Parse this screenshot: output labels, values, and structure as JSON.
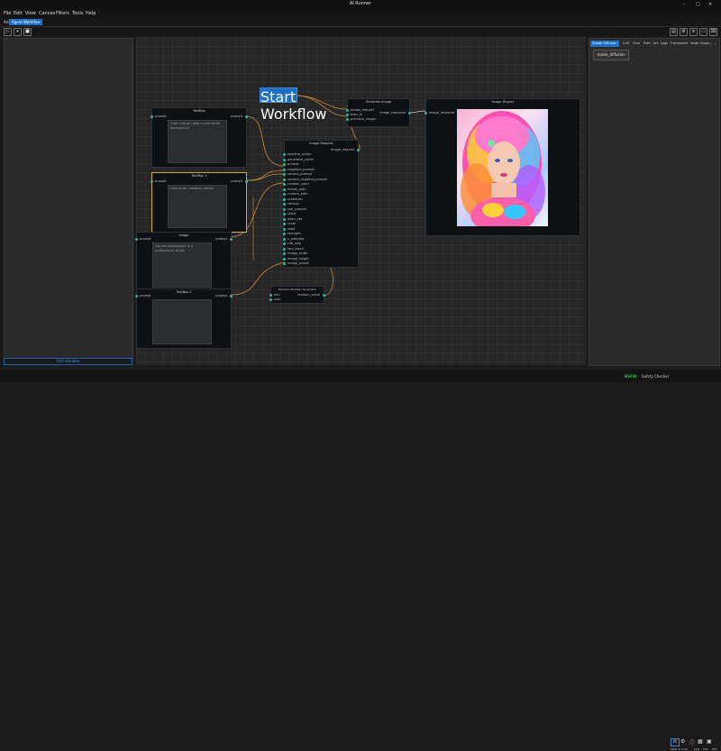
{
  "window": {
    "title": "AI Runner"
  },
  "menu": [
    "File",
    "Edit",
    "View",
    "Canvas",
    "Filters",
    "Tools",
    "Help"
  ],
  "tabs": {
    "home": "Art",
    "active": "Agent Workflow"
  },
  "left_panel": {
    "bottom_button": "Add Variable"
  },
  "nodes": {
    "start": {
      "title": "Start Workflow"
    },
    "textbox1": {
      "title": "TextBox",
      "in_port": "prompt",
      "out_port": "prompt",
      "text": "Cute cute girl with a cute smile, background"
    },
    "textbox2": {
      "title": "TextBox 1",
      "in_port": "prompt",
      "out_port": "prompt",
      "text": "Halo drum, drawing, sketch"
    },
    "textbox3": {
      "title": "Image",
      "in_port": "prompt",
      "out_port": "prompt",
      "text": "Fashion photograph in a professional studio"
    },
    "textbox4": {
      "title": "TextBox 2",
      "in_port": "prompt",
      "out_port": "prompt",
      "text": ""
    },
    "generate": {
      "title": "Generate Image",
      "inputs": [
        "image_request",
        "exec_in",
        "previous_image"
      ],
      "output": "image_response"
    },
    "display": {
      "title": "Image Display",
      "input": "image_response"
    },
    "request": {
      "title": "Image Request",
      "output": "image_request",
      "inputs": [
        "pipeline_action",
        "generator_name",
        "prompt",
        "negative_prompt",
        "second_prompt",
        "second_negative_prompt",
        "random_seed",
        "model_path",
        "custom_path",
        "scheduler",
        "version",
        "use_compel",
        "steps",
        "ddim_eta",
        "scale",
        "seed",
        "strength",
        "n_samples",
        "clip_skip",
        "lora_block",
        "image_width",
        "image_height",
        "image_preset"
      ]
    },
    "random": {
      "title": "Random Number Generator",
      "inputs": [
        "min",
        "max"
      ],
      "output": "random_value"
    }
  },
  "right_panel": {
    "tabs": [
      "Stable Diffusion",
      "LLM",
      "Chat",
      "Path",
      "Art",
      "Logs",
      "Framework",
      "Node Graph"
    ],
    "active_tab": "Stable Diffusion",
    "field": "stable_diffusion"
  },
  "status": {
    "nsfw": "NSFW",
    "safety": "Safety Checker",
    "model": "SDXL 1.0 C4",
    "llm": "LLM",
    "tts": "TTS",
    "stt": "STT",
    "nsfw_color": "#18c23a"
  }
}
